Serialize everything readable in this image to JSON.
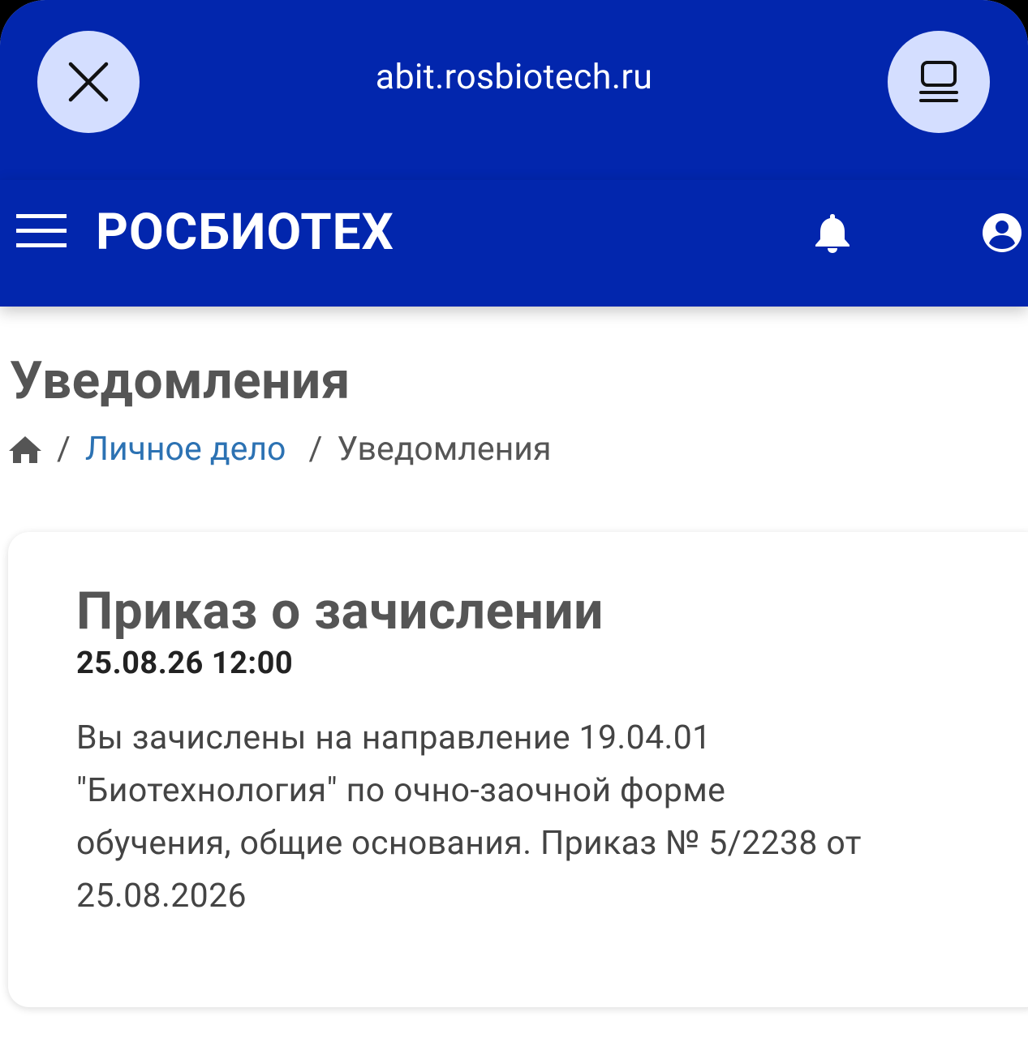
{
  "browser": {
    "url": "abit.rosbiotech.ru"
  },
  "header": {
    "brand": "РОСБИОТЕХ"
  },
  "page": {
    "title": "Уведомления"
  },
  "breadcrumb": {
    "separator": "/",
    "items": [
      "Личное дело",
      "Уведомления"
    ]
  },
  "notification": {
    "title": "Приказ о зачислении",
    "datetime": "25.08.26 12:00",
    "lines": [
      "Вы зачислены на направление 19.04.01",
      "\"Биотехнология\" по очно-заочной форме",
      "обучения, общие основания. Приказ № 5/2238 от",
      "25.08.2026"
    ]
  },
  "colors": {
    "header_bg": "#0226ad",
    "round_button_bg": "#d4deff",
    "link": "#2c72b3",
    "heading_text": "#555555"
  },
  "icons": [
    "close-icon",
    "tabs-icon",
    "menu-icon",
    "bell-icon",
    "user-icon",
    "home-icon"
  ]
}
